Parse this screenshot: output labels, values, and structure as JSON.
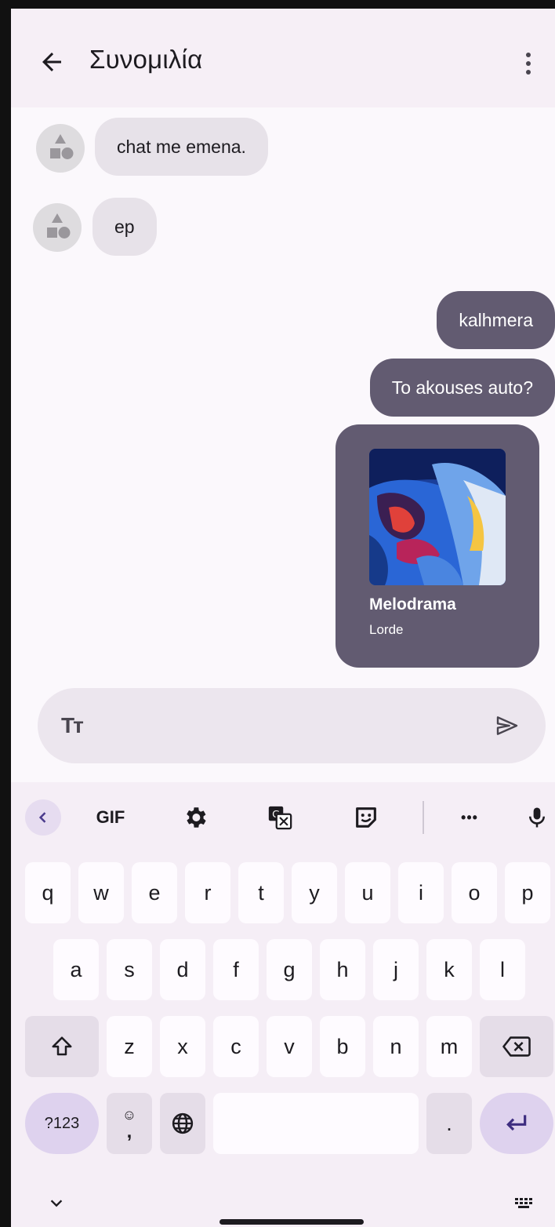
{
  "header": {
    "title": "Συνομιλία"
  },
  "messages": {
    "incoming": [
      {
        "text": "chat me emena."
      },
      {
        "text": "ep"
      }
    ],
    "outgoing": [
      {
        "text": "kalhmera"
      },
      {
        "text": "To akouses auto?"
      }
    ],
    "music_card": {
      "title": "Melodrama",
      "artist": "Lorde"
    }
  },
  "compose": {
    "format_label": "Tт"
  },
  "keyboard": {
    "toolbar": {
      "gif_label": "GIF",
      "more_label": "•••"
    },
    "row1": [
      "q",
      "w",
      "e",
      "r",
      "t",
      "y",
      "u",
      "i",
      "o",
      "p"
    ],
    "row2": [
      "a",
      "s",
      "d",
      "f",
      "g",
      "h",
      "j",
      "k",
      "l"
    ],
    "row3": [
      "z",
      "x",
      "c",
      "v",
      "b",
      "n",
      "m"
    ],
    "symbols_label": "?123",
    "period_label": ".",
    "comma_label": ","
  },
  "colors": {
    "accent": "#625b71",
    "enter_key": "#ded2ee",
    "bubble_incoming": "#e7e2e9"
  }
}
